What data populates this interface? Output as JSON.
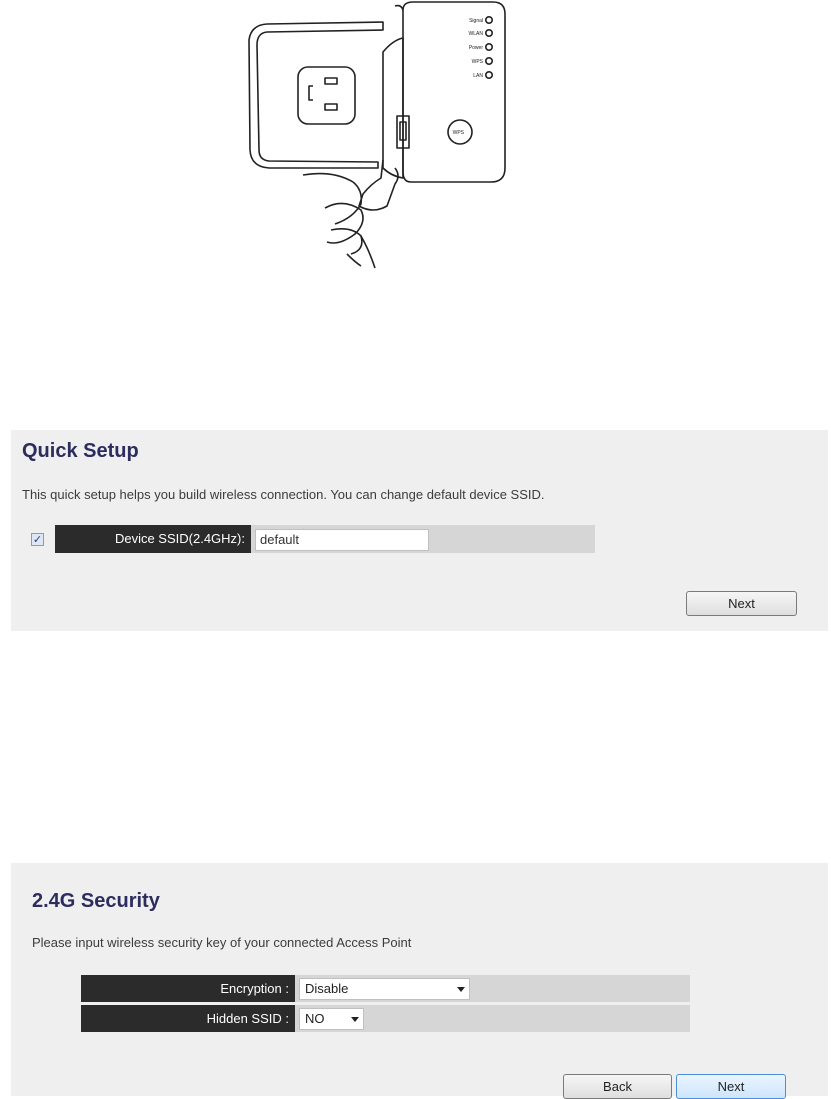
{
  "illustration": {
    "led_labels": [
      "Signal",
      "WLAN",
      "Power",
      "WPS",
      "LAN"
    ],
    "button_label": "WPS"
  },
  "quick_setup": {
    "title": "Quick Setup",
    "description": "This quick setup helps you build wireless connection. You can change default device SSID.",
    "ssid_checkbox_checked": true,
    "ssid_label": "Device SSID(2.4GHz):",
    "ssid_value": "default",
    "next_label": "Next"
  },
  "security": {
    "title": "2.4G Security",
    "description": "Please input wireless security key of your connected Access Point",
    "encryption_label": "Encryption :",
    "encryption_value": "Disable",
    "hidden_ssid_label": "Hidden SSID :",
    "hidden_ssid_value": "NO",
    "back_label": "Back",
    "next_label": "Next"
  }
}
